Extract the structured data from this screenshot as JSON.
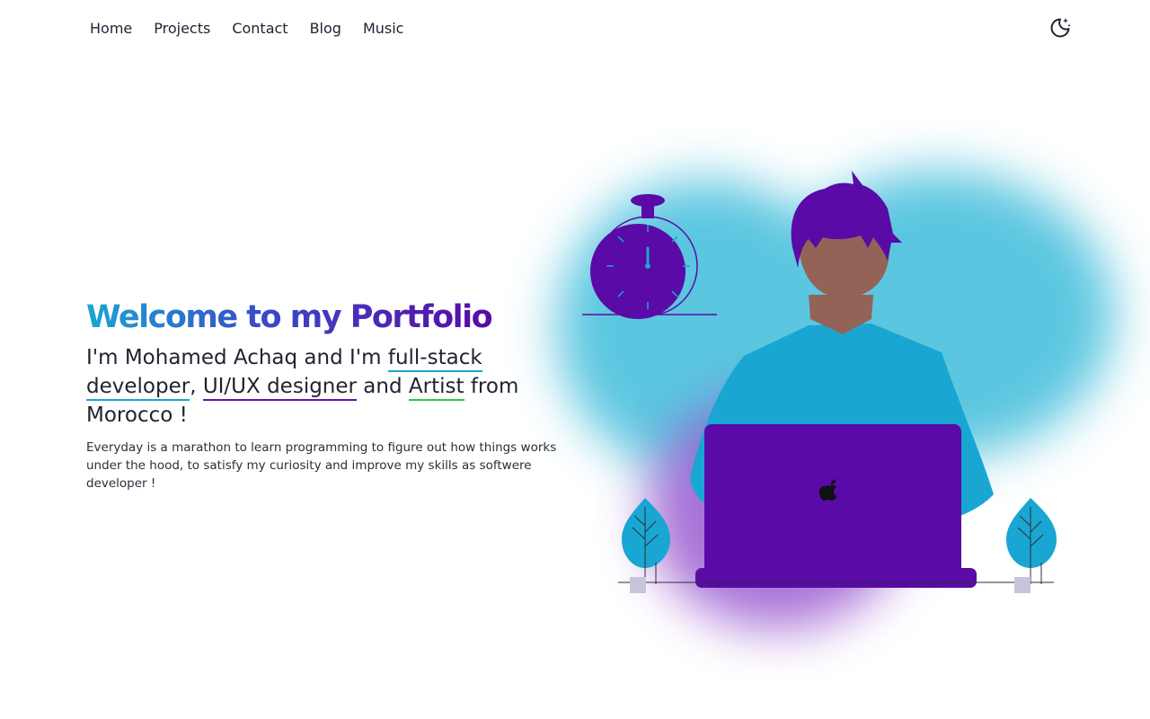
{
  "nav": {
    "items": [
      {
        "label": "Home"
      },
      {
        "label": "Projects"
      },
      {
        "label": "Contact"
      },
      {
        "label": "Blog"
      },
      {
        "label": "Music"
      }
    ],
    "theme_icon": "moon-stars-icon"
  },
  "hero": {
    "title": "Welcome to my Portfolio",
    "intro_prefix": "I'm Mohamed Achaq and I'm ",
    "role_fullstack": "full-stack developer",
    "sep_comma": ", ",
    "role_uiux": "UI/UX designer",
    "sep_and": " and ",
    "role_artist": "Artist",
    "intro_suffix": " from Morocco !",
    "description": "Everyday is a marathon to learn programming to figure out how things works under the hood, to satisfy my curiosity and improve my skills as softwere developer !"
  },
  "colors": {
    "accent_cyan": "#1aa6d2",
    "accent_purple": "#5a0aa6",
    "accent_green": "#2ecc40"
  },
  "illustration": {
    "icons": [
      "stopwatch-icon",
      "person-illustration",
      "laptop-icon",
      "apple-logo-icon",
      "tree-icon"
    ]
  }
}
